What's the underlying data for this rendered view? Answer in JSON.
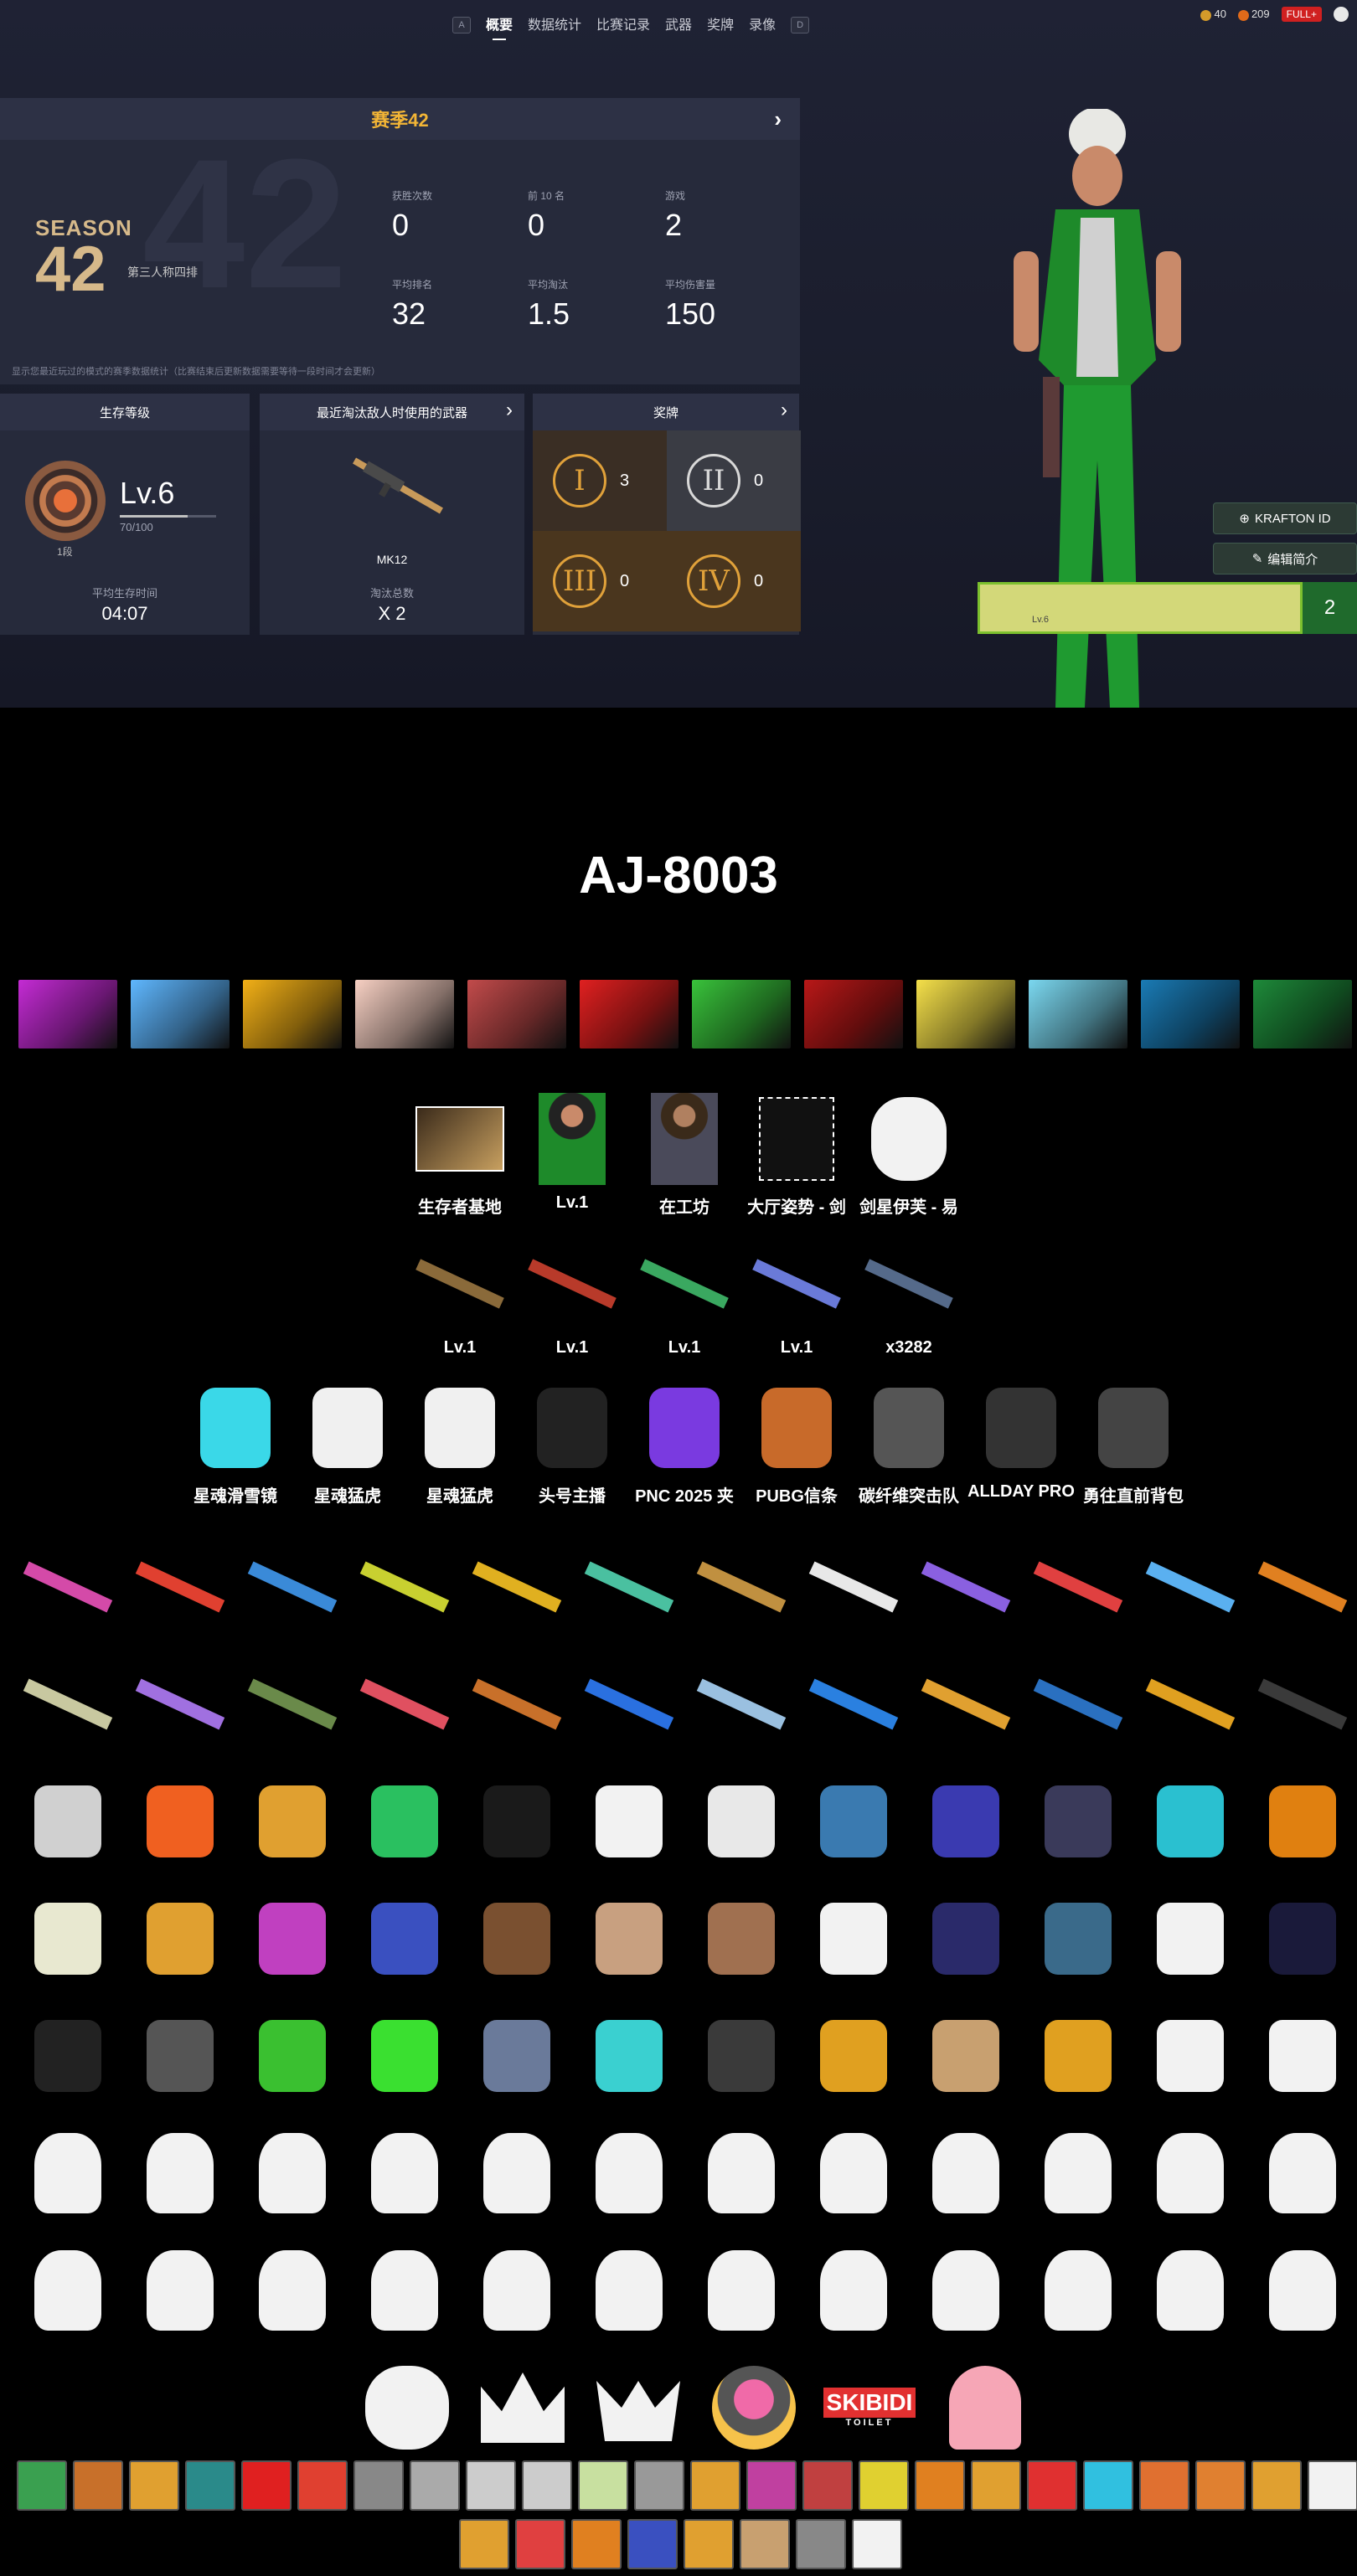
{
  "nav": {
    "tabs": [
      "概要",
      "数据统计",
      "比赛记录",
      "武器",
      "奖牌",
      "录像"
    ],
    "left_key": "A",
    "right_key": "D"
  },
  "currency": {
    "c1": "40",
    "c2": "209",
    "badge": "FULL+"
  },
  "season": {
    "title": "赛季42",
    "logo_word": "SEASON",
    "logo_num": "42",
    "bg_num": "42",
    "mode": "第三人称四排",
    "note": "显示您最近玩过的模式的赛季数据统计（比赛结束后更新数据需要等待一段时间才会更新）",
    "stats": [
      {
        "label": "获胜次数",
        "value": "0"
      },
      {
        "label": "前 10 名",
        "value": "0"
      },
      {
        "label": "游戏",
        "value": "2"
      },
      {
        "label": "平均排名",
        "value": "32"
      },
      {
        "label": "平均淘汰",
        "value": "1.5"
      },
      {
        "label": "平均伤害量",
        "value": "150"
      }
    ]
  },
  "survival": {
    "title": "生存等级",
    "level": "Lv.6",
    "xp": "70/100",
    "xp_fraction": 0.7,
    "rank": "1段",
    "sub_label": "平均生存时间",
    "sub_value": "04:07"
  },
  "weapon": {
    "title": "最近淘汰敌人时使用的武器",
    "name": "MK12",
    "sub_label": "淘汰总数",
    "sub_value": "X 2"
  },
  "medals": {
    "title": "奖牌",
    "items": [
      {
        "sym": "I",
        "count": "3"
      },
      {
        "sym": "II",
        "count": "0"
      },
      {
        "sym": "III",
        "count": "0"
      },
      {
        "sym": "IV",
        "count": "0"
      }
    ]
  },
  "profile": {
    "krafton": "KRAFTON ID",
    "edit": "编辑简介",
    "nameplate_lv": "Lv.6",
    "box_num": "2"
  },
  "player_name": "AJ-8003",
  "banner_colors": [
    "#c42bd4",
    "#5fb7ff",
    "#f2b017",
    "#f7d0c3",
    "#c24b4b",
    "#e02020",
    "#39c23b",
    "#b81818",
    "#f5e04a",
    "#7bd8f0",
    "#1a7bb5",
    "#1e8a3a"
  ],
  "lobby": [
    {
      "label": "生存者基地"
    },
    {
      "label": "Lv.1"
    },
    {
      "label": "在工坊"
    },
    {
      "label": "大厅姿势 - 剑"
    },
    {
      "label": "剑星伊芙 - 易"
    }
  ],
  "weapons_row": [
    {
      "label": "Lv.1"
    },
    {
      "label": "Lv.1"
    },
    {
      "label": "Lv.1"
    },
    {
      "label": "Lv.1"
    },
    {
      "label": "x3282"
    }
  ],
  "outfits": [
    {
      "label": "星魂滑雪镜"
    },
    {
      "label": "星魂猛虎"
    },
    {
      "label": "星魂猛虎"
    },
    {
      "label": "头号主播"
    },
    {
      "label": "PNC 2025 夹"
    },
    {
      "label": "PUBG信条"
    },
    {
      "label": "碳纤维突击队"
    },
    {
      "label": "ALLDAY PRO"
    },
    {
      "label": "勇往直前背包"
    }
  ],
  "skibidi": {
    "top": "SKIBIDI",
    "bottom": "TOILET"
  }
}
